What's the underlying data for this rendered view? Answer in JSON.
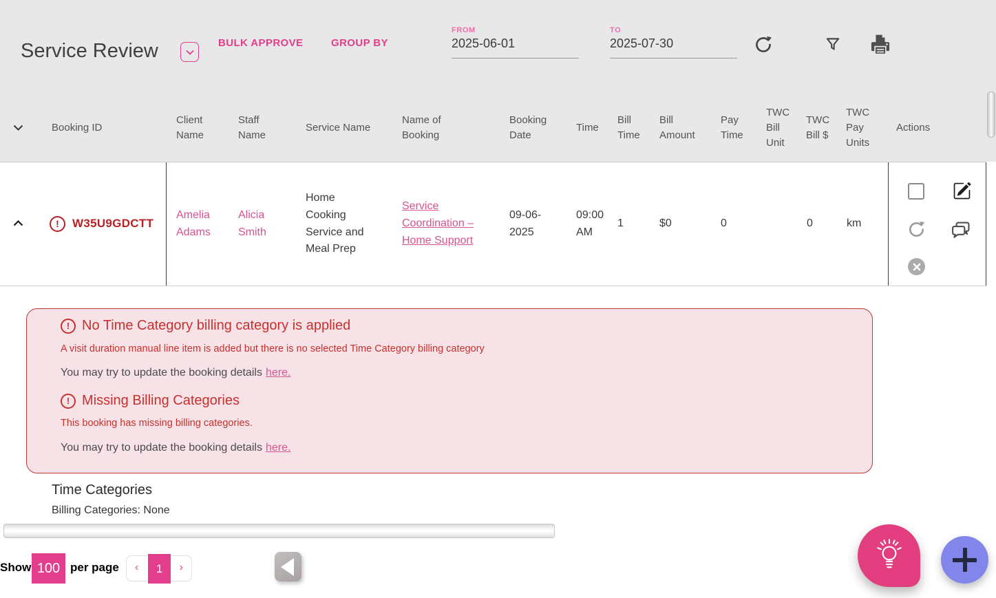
{
  "colors": {
    "accent_pink": "#e23e8b",
    "name_link_pink": "#d6538f",
    "field_label_pink": "#ee6fa9",
    "booking_id_red": "#b71f23",
    "alert_red": "#c9302c",
    "alert_background": "#f7e3e7",
    "fab_purple": "#8286ea",
    "top_background_gray": "#e9e8e8"
  },
  "toolbar": {
    "title": "Service Review",
    "bulk_approve": "BULK APPROVE",
    "group_by": "GROUP BY",
    "from": {
      "label": "FROM",
      "value": "2025-06-01"
    },
    "to": {
      "label": "TO",
      "value": "2025-07-30"
    }
  },
  "table": {
    "headers": {
      "booking_id": "Booking ID",
      "client_name": "Client Name",
      "staff_name": "Staff Name",
      "service_name": "Service Name",
      "name_of_booking": "Name of Booking",
      "booking_date": "Booking Date",
      "time": "Time",
      "bill_time": "Bill Time",
      "bill_amount": "Bill Amount",
      "pay_time": "Pay Time",
      "twc_bill_unit": "TWC Bill Unit",
      "twc_bill_dollar": "TWC Bill $",
      "twc_pay_units": "TWC Pay Units",
      "actions": "Actions"
    },
    "row": {
      "booking_id": "W35U9GDCTT",
      "client_name": "Amelia Adams",
      "staff_name": "Alicia Smith",
      "service_name": "Home Cooking Service and Meal Prep",
      "name_of_booking": "Service Coordination – Home Support",
      "booking_date": "09-06-2025",
      "time": "09:00 AM",
      "bill_time": "1",
      "bill_amount": "$0",
      "pay_time": "0",
      "twc_bill_unit": "",
      "twc_bill_dollar": "0",
      "twc_pay_units": "km"
    }
  },
  "alerts": [
    {
      "title": "No Time Category billing category is applied",
      "detail": "A visit duration manual line item is added but there is no selected Time Category billing category",
      "update_text": "You may try to update the booking details",
      "link_text": "here."
    },
    {
      "title": "Missing Billing Categories",
      "detail": "This booking has missing billing categories.",
      "update_text": "You may try to update the booking details",
      "link_text": "here."
    }
  ],
  "time_categories": {
    "heading": "Time Categories",
    "billing_categories": "Billing Categories: None"
  },
  "footer": {
    "show_label": "Show",
    "page_size": "100",
    "per_page_label": "per page",
    "pagination": {
      "prev": "‹",
      "current_page": "1",
      "next": "›"
    }
  }
}
